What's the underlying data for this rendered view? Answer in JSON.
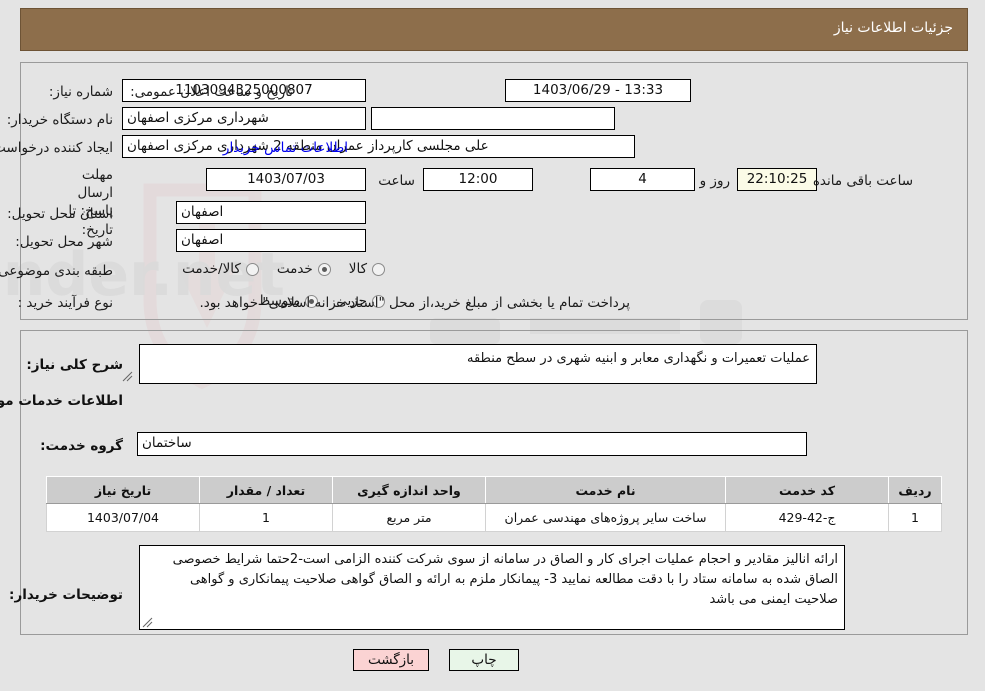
{
  "header": {
    "title": "جزئیات اطلاعات نیاز",
    "bar_color": "#8d6e4b"
  },
  "form": {
    "need_number_label": "شماره نیاز:",
    "need_number_value": "1103094325000807",
    "public_announce_label": "تاریخ و ساعت اعلان عمومی:",
    "public_announce_value": "13:33 - 1403/06/29",
    "buyer_org_label": "نام دستگاه خریدار:",
    "buyer_org_value": "شهرداری مرکزی اصفهان",
    "blank_field_value": "",
    "requester_label": "ایجاد کننده درخواست:",
    "requester_value": "علی مجلسی کارپرداز عمران منطقه 2 شهرداری مرکزی اصفهان",
    "buyer_contact_link": "اطلاعات تماس خریدار",
    "deadline_label": "مهلت ارسال پاسخ: تا تاریخ:",
    "deadline_date": "1403/07/03",
    "deadline_hour_label": "ساعت",
    "deadline_hour_value": "12:00",
    "remaining_days_value": "4",
    "remaining_days_unit": "روز و",
    "remaining_time_value": "22:10:25",
    "remaining_time_unit": "ساعت باقی مانده",
    "province_label": "استان محل تحویل:",
    "province_value": "اصفهان",
    "city_label": "شهر محل تحویل:",
    "city_value": "اصفهان",
    "category_label": "طبقه بندی موضوعی:",
    "category_options": [
      {
        "label": "کالا",
        "selected": false
      },
      {
        "label": "خدمت",
        "selected": true
      },
      {
        "label": "کالا/خدمت",
        "selected": false
      }
    ],
    "process_label": "نوع فرآیند خرید :",
    "process_options": [
      {
        "label": "جزیی",
        "selected": false
      },
      {
        "label": "متوسط",
        "selected": true
      }
    ],
    "process_note": "پرداخت تمام یا بخشی از مبلغ خرید،از محل \"اسناد خزانه اسلامی\" خواهد بود."
  },
  "description": {
    "label": "شرح کلی نیاز:",
    "value": "عملیات تعمیرات و نگهداری معابر و ابنیه شهری در سطح منطقه"
  },
  "services": {
    "section_title": "اطلاعات خدمات مورد نیاز",
    "group_label": "گروه خدمت:",
    "group_value": "ساختمان",
    "table": {
      "columns": [
        "ردیف",
        "کد خدمت",
        "نام خدمت",
        "واحد اندازه گیری",
        "تعداد / مقدار",
        "تاریخ نیاز"
      ],
      "rows": [
        {
          "row": "1",
          "code": "ج-42-429",
          "name": "ساخت سایر پروژه‌های مهندسی عمران",
          "unit": "متر مربع",
          "qty": "1",
          "date": "1403/07/04"
        }
      ]
    }
  },
  "buyer_notes": {
    "label": "توضیحات خریدار:",
    "value": "ارائه انالیز مقادیر و احجام عملیات اجرای کار و الصاق در سامانه از سوی شرکت کننده الزامی است-2حتما شرایط خصوصی الصاق شده به سامانه ستاد را با دقت مطالعه نمایید 3- پیمانکار ملزم به ارائه و الصاق گواهی صلاحیت پیمانکاری و گواهی صلاحیت ایمنی می باشد"
  },
  "footer": {
    "print_label": "چاپ",
    "back_label": "بازگشت"
  }
}
